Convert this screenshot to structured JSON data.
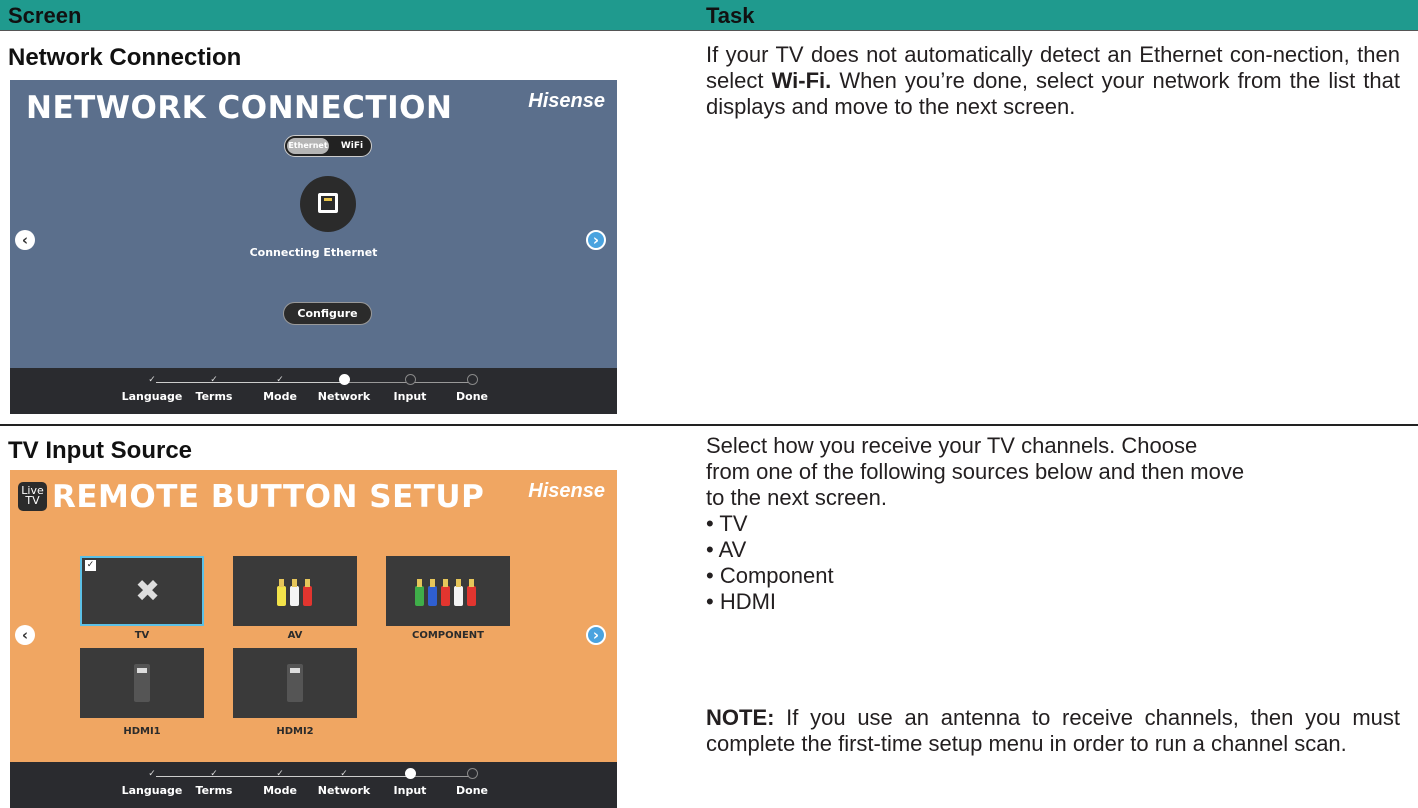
{
  "header": {
    "screen": "Screen",
    "task": "Task"
  },
  "sections": [
    {
      "title": "Network Connection",
      "task_lines": [
        {
          "pre": "If your TV does not automatically detect an Ethernet con-nection, then select ",
          "bold": "Wi-Fi.",
          "post": " When you’re done, select your network from the list that displays and move to the next screen."
        }
      ],
      "tv": {
        "title": "NETWORK CONNECTION",
        "brand": "Hisense",
        "toggle_on": "Ethernet",
        "toggle_off": "WiFi",
        "status": "Connecting Ethernet",
        "configure": "Configure",
        "steps": [
          "Language",
          "Terms",
          "Mode",
          "Network",
          "Input",
          "Done"
        ],
        "current_step": 3
      }
    },
    {
      "title": "TV Input Source",
      "task_intro": [
        "Select how you receive your TV channels. Choose",
        "from one of the following sources below and then move",
        "to the next screen."
      ],
      "sources": [
        "• TV",
        "• AV",
        "• Component",
        "• HDMI"
      ],
      "note_label": "NOTE:",
      "note_text": " If you use an antenna to receive channels, then you must complete the first-time setup menu in order to run a channel scan.",
      "tv": {
        "badge_top": "Live",
        "badge_bottom": "TV",
        "title": "REMOTE BUTTON SETUP",
        "brand": "Hisense",
        "tiles": [
          "TV",
          "AV",
          "COMPONENT",
          "HDMI1",
          "HDMI2"
        ],
        "selected_tile": "TV",
        "steps": [
          "Language",
          "Terms",
          "Mode",
          "Network",
          "Input",
          "Done"
        ],
        "current_step": 4
      }
    }
  ],
  "icons": [
    "chevron-left-icon",
    "chevron-right-icon",
    "ethernet-port-icon",
    "check-icon",
    "coax-connector-icon",
    "rca-connector-icon",
    "hdmi-connector-icon"
  ],
  "colors": {
    "header": "#1f9a8e",
    "network_bg": "#5b6f8c",
    "input_bg": "#f0a662",
    "progress_bg": "#2a2b2f",
    "selected_border": "#5cc0e6"
  }
}
